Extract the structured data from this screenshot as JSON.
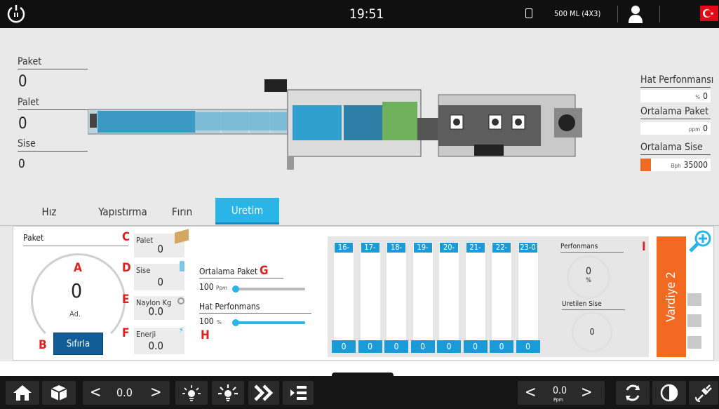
{
  "topbar": {
    "time": "19:51",
    "product": "500 ML (4X3)",
    "colors": {
      "bg": "#101010",
      "flag": "#e30a17"
    }
  },
  "counters": {
    "paket_label": "Paket",
    "paket_value": "0",
    "palet_label": "Palet",
    "palet_value": "0",
    "sise_label": "Sise",
    "sise_value": "0"
  },
  "right_stats": {
    "hat_label": "Hat Perfonmansı",
    "hat_unit": "%",
    "hat_value": "0",
    "ortpaket_label": "Ortalama Paket",
    "ortpaket_unit": "ppm",
    "ortpaket_value": "0",
    "ortsise_label": "Ortalama Sise",
    "ortsise_unit": "Bph",
    "ortsise_value": "35000",
    "ortsise_fill_fraction": 0.15
  },
  "tabs": [
    "Hız",
    "Yapıstırma",
    "Fırın",
    "Uretim"
  ],
  "active_tab": "Uretim",
  "panel": {
    "paket_label": "Paket",
    "gauge_value": "0",
    "gauge_unit": "Ad.",
    "reset_label": "Sıfırla",
    "markers": {
      "A": "A",
      "B": "B",
      "C": "C",
      "D": "D",
      "E": "E",
      "F": "F",
      "G": "G",
      "H": "H",
      "I": "I"
    },
    "palet_label": "Palet",
    "palet_value": "0",
    "sise_label": "Sise",
    "sise_value": "0",
    "naylon_label": "Naylon Kg",
    "naylon_value": "0.0",
    "enerji_label": "Enerji",
    "enerji_value": "0.0",
    "ortpaket_label": "Ortalama Paket",
    "ortpaket_value": "100",
    "ortpaket_unit": "Ppm",
    "hatperf_label": "Hat Perfonmans",
    "hatperf_value": "100",
    "hatperf_unit": "%",
    "shifts": [
      {
        "label": "16-17",
        "value": "0"
      },
      {
        "label": "17-18",
        "value": "0"
      },
      {
        "label": "18-19",
        "value": "0"
      },
      {
        "label": "19-20",
        "value": "0"
      },
      {
        "label": "20-21",
        "value": "0"
      },
      {
        "label": "21-22",
        "value": "0"
      },
      {
        "label": "22-23",
        "value": "0"
      },
      {
        "label": "23-0",
        "value": "0"
      }
    ],
    "perf_label": "Perfonmans",
    "perf_value": "0",
    "perf_unit": "%",
    "uretilen_label": "Uretilen Sise",
    "uretilen_value": "0",
    "vardiye": "Vardiye 2",
    "colors": {
      "accent": "#1a9bd7",
      "vardiye": "#f26a22",
      "marker": "#e02020"
    }
  },
  "bottombar": {
    "speed_left_prev": "<",
    "speed_left_value": "0.0",
    "speed_left_next": ">",
    "speed_right_prev": "<",
    "speed_right_value": "0.0",
    "speed_right_unit": "Ppm",
    "speed_right_next": ">"
  }
}
